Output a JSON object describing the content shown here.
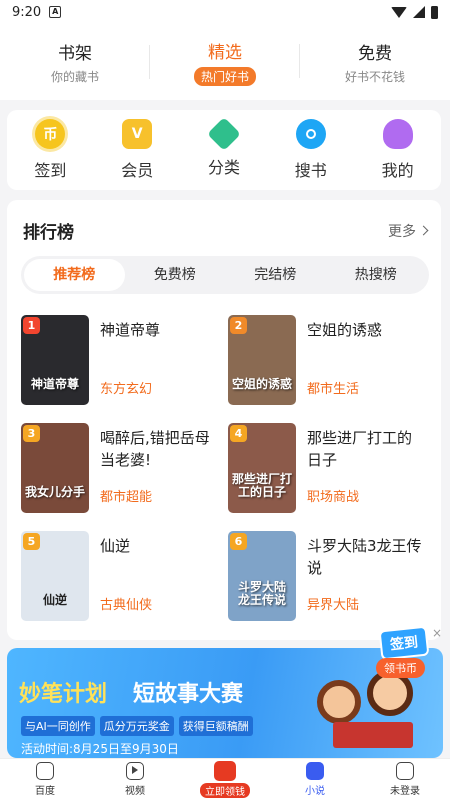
{
  "status_bar": {
    "time": "9:20",
    "notif_icon": "A"
  },
  "top_tabs": [
    {
      "title": "书架",
      "subtitle": "你的藏书"
    },
    {
      "title": "精选",
      "subtitle": "热门好书"
    },
    {
      "title": "免费",
      "subtitle": "好书不花钱"
    }
  ],
  "quick_links": [
    {
      "label": "签到",
      "icon": "sign-in-coin-icon",
      "glyph": "币"
    },
    {
      "label": "会员",
      "icon": "vip-crown-icon",
      "glyph": "V"
    },
    {
      "label": "分类",
      "icon": "category-layers-icon",
      "glyph": ""
    },
    {
      "label": "搜书",
      "icon": "search-icon",
      "glyph": ""
    },
    {
      "label": "我的",
      "icon": "profile-icon",
      "glyph": ""
    }
  ],
  "ranking": {
    "title": "排行榜",
    "more": "更多",
    "tabs": [
      "推荐榜",
      "免费榜",
      "完结榜",
      "热搜榜"
    ],
    "books": [
      {
        "rank": "1",
        "name": "神道帝尊",
        "tag": "东方玄幻",
        "cover_text": "神道帝尊",
        "cover_color": "#2a2a2e",
        "rank_color": "#f2452f"
      },
      {
        "rank": "2",
        "name": "空姐的诱惑",
        "tag": "都市生活",
        "cover_text": "空姐的诱惑",
        "cover_color": "#8a6a52",
        "rank_color": "#f08a2a"
      },
      {
        "rank": "3",
        "name": "喝醉后,错把岳母当老婆!",
        "tag": "都市超能",
        "cover_text": "我女儿分手",
        "cover_color": "#7a4a3a",
        "rank_color": "#f5a623"
      },
      {
        "rank": "4",
        "name": "那些进厂打工的日子",
        "tag": "职场商战",
        "cover_text": "那些进厂打工的日子",
        "cover_color": "#8c5a4a",
        "rank_color": "#f5a623"
      },
      {
        "rank": "5",
        "name": "仙逆",
        "tag": "古典仙侠",
        "cover_text": "仙逆",
        "cover_color": "#dfe6ee",
        "rank_color": "#f5a623"
      },
      {
        "rank": "6",
        "name": "斗罗大陆3龙王传说",
        "tag": "异界大陆",
        "cover_text": "斗罗大陆 龙王传说",
        "cover_color": "#7fa3c8",
        "rank_color": "#f5a623"
      }
    ]
  },
  "banner": {
    "brand": "妙笔计划",
    "headline": "短故事大赛",
    "pills": [
      "与AI一同创作",
      "瓜分万元奖金",
      "获得巨额稿酬"
    ],
    "date": "活动时间:8月25日至9月30日"
  },
  "float_badge": {
    "sign": "签到",
    "coin": "领书币",
    "close": "×"
  },
  "bottom_nav": [
    {
      "label": "百度",
      "icon": "baidu-home-icon"
    },
    {
      "label": "视频",
      "icon": "video-play-icon"
    },
    {
      "label": "立即领钱",
      "icon": "red-envelope-icon"
    },
    {
      "label": "小说",
      "icon": "novel-book-icon"
    },
    {
      "label": "未登录",
      "icon": "user-face-icon"
    }
  ],
  "colors": {
    "accent": "#f26b1d",
    "nav_active": "#3a5cf0"
  }
}
